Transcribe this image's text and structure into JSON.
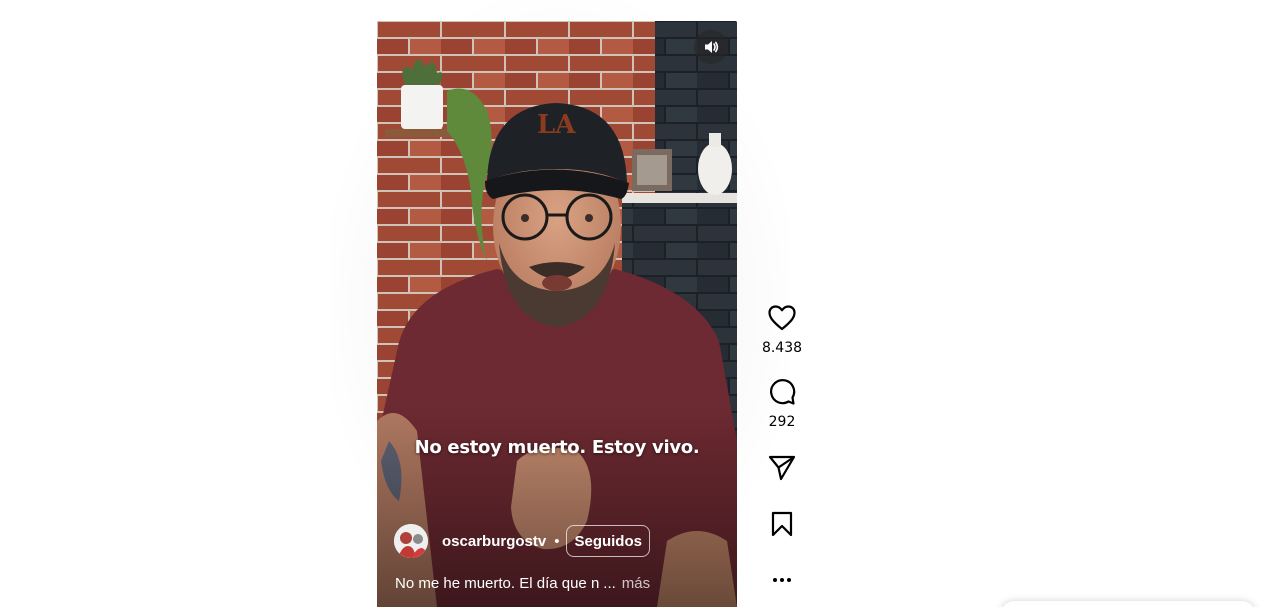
{
  "reel": {
    "subtitle": "No estoy muerto. Estoy vivo.",
    "author": {
      "username": "oscarburgostv",
      "separator": "•",
      "follow_label": "Seguidos"
    },
    "caption": {
      "text": "No me he muerto. El día que n",
      "ellipsis": "...",
      "more_label": "más"
    },
    "mute_icon": "speaker-on-icon"
  },
  "actions": {
    "like": {
      "icon": "heart-icon",
      "count": "8.438"
    },
    "comment": {
      "icon": "comment-icon",
      "count": "292"
    },
    "share": {
      "icon": "paper-plane-icon"
    },
    "save": {
      "icon": "bookmark-icon"
    },
    "more": {
      "icon": "more-horizontal-icon"
    }
  },
  "colors": {
    "text_dark": "#000000",
    "overlay_text": "#ffffff",
    "background": "#ffffff"
  }
}
